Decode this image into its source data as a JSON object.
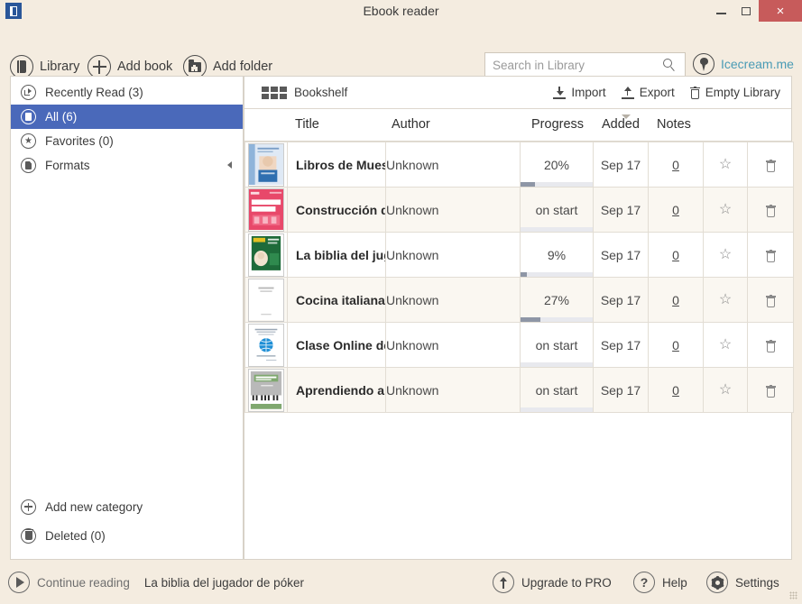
{
  "window": {
    "title": "Ebook reader",
    "app_icon": "book-app-icon",
    "minimize_label": "–",
    "maximize_label": "□",
    "close_label": "×"
  },
  "toolbar": {
    "library_label": "Library",
    "add_book_label": "Add book",
    "add_folder_label": "Add folder",
    "brand_label": "Icecream.me"
  },
  "search": {
    "placeholder": "Search in Library",
    "value": ""
  },
  "sidebar": {
    "items": [
      {
        "label": "Recently Read (3)",
        "icon": "recently-read-icon",
        "selected": false
      },
      {
        "label": "All (6)",
        "icon": "all-books-icon",
        "selected": true
      },
      {
        "label": "Favorites (0)",
        "icon": "star-icon",
        "selected": false
      },
      {
        "label": "Formats",
        "icon": "formats-icon",
        "selected": false,
        "has_arrow": true
      }
    ],
    "bottom_items": [
      {
        "label": "Add new category",
        "icon": "plus-circle-icon"
      },
      {
        "label": "Deleted (0)",
        "icon": "trash-circle-icon"
      }
    ]
  },
  "content_header": {
    "shelf_label": "Bookshelf",
    "grid_icon": "grid-view-icon",
    "actions": [
      {
        "label": "Import",
        "icon": "import-icon"
      },
      {
        "label": "Export",
        "icon": "export-icon"
      },
      {
        "label": "Empty Library",
        "icon": "trash-icon"
      }
    ]
  },
  "table": {
    "columns": [
      "Title",
      "Author",
      "Progress",
      "Added",
      "Notes"
    ],
    "sorted_column": "Added",
    "sort_direction": "descending",
    "rows": [
      {
        "title": "Libros de Muestra",
        "author": "Unknown",
        "progress_label": "20%",
        "progress_pct": 20,
        "added": "Sep 17",
        "notes": "0",
        "favorite": false,
        "cover": "cover-blue-face"
      },
      {
        "title": "Construcción de",
        "author": "Unknown",
        "progress_label": "on start",
        "progress_pct": 0,
        "added": "Sep 17",
        "notes": "0",
        "favorite": false,
        "cover": "cover-red-pink"
      },
      {
        "title": "La biblia del jugador de póker",
        "author": "Unknown",
        "progress_label": "9%",
        "progress_pct": 9,
        "added": "Sep 17",
        "notes": "0",
        "favorite": false,
        "cover": "cover-green"
      },
      {
        "title": "Cocina italiana",
        "author": "Unknown",
        "progress_label": "27%",
        "progress_pct": 27,
        "added": "Sep 17",
        "notes": "0",
        "favorite": false,
        "cover": "cover-white-plain"
      },
      {
        "title": "Clase Online de",
        "author": "Unknown",
        "progress_label": "on start",
        "progress_pct": 0,
        "added": "Sep 17",
        "notes": "0",
        "favorite": false,
        "cover": "cover-globe"
      },
      {
        "title": "Aprendiendo a",
        "author": "Unknown",
        "progress_label": "on start",
        "progress_pct": 0,
        "added": "Sep 17",
        "notes": "0",
        "favorite": false,
        "cover": "cover-piano-grey"
      }
    ],
    "favorite_icon": "star-outline-icon",
    "delete_icon": "trash-icon"
  },
  "statusbar": {
    "continue_label": "Continue reading",
    "continue_book": "La biblia del jugador de póker",
    "upgrade_label": "Upgrade to PRO",
    "help_label": "Help",
    "settings_label": "Settings"
  },
  "colors": {
    "window_bg": "#f4ece0",
    "accent_selected": "#4a69ba",
    "close_button": "#c75b5b",
    "brand_link": "#4a9bb5",
    "progress_fill": "#8e96a6",
    "progress_track": "#e8e9ee",
    "row_alt": "#faf7f1"
  }
}
